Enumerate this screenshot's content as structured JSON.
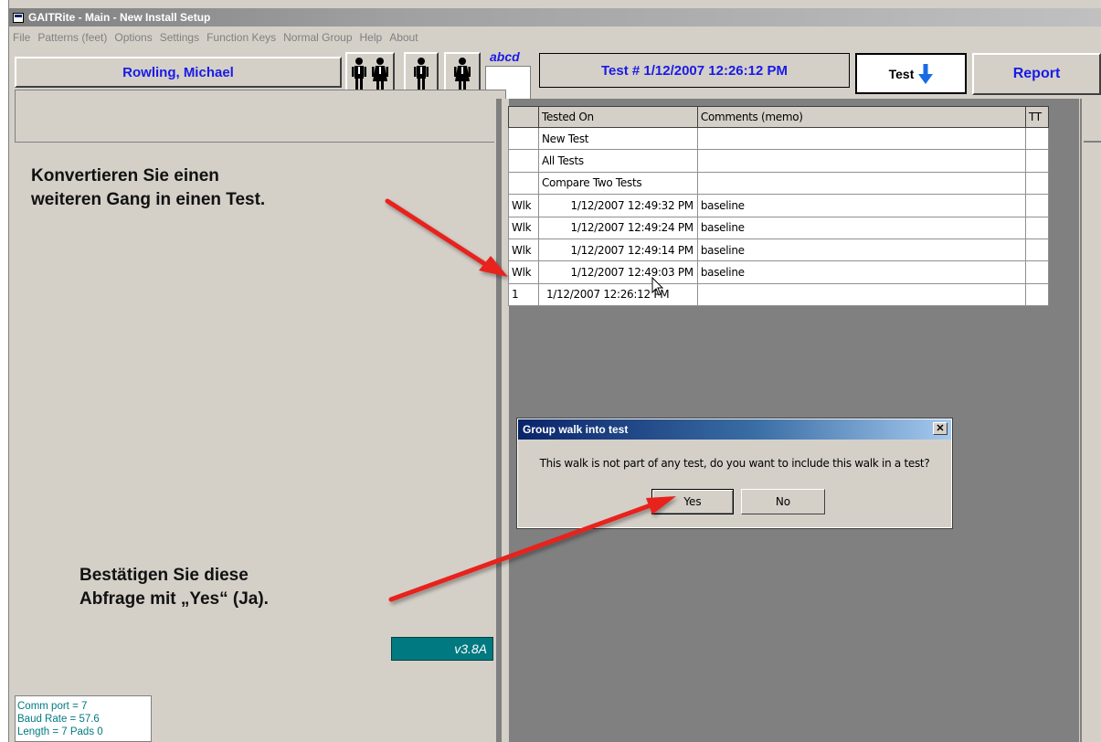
{
  "window": {
    "title": "GAITRite  - Main - New Install Setup"
  },
  "menu": [
    "File",
    "Patterns (feet)",
    "Options",
    "Settings",
    "Function Keys",
    "Normal Group",
    "Help",
    "About"
  ],
  "toolbar": {
    "patient_name": "Rowling, Michael",
    "abcd_label": "abcd",
    "test_label": "Test # 1/12/2007 12:26:12 PM",
    "test_down_label": "Test",
    "report_label": "Report"
  },
  "tests_table": {
    "headers": [
      "",
      "Tested On",
      "Comments (memo)",
      "TT"
    ],
    "rows": [
      {
        "type": "",
        "date": "New Test",
        "comment": "",
        "tt": ""
      },
      {
        "type": "",
        "date": "All Tests",
        "comment": "",
        "tt": ""
      },
      {
        "type": "",
        "date": "Compare Two Tests",
        "comment": "",
        "tt": ""
      },
      {
        "type": "Wlk",
        "date": "1/12/2007 12:49:32 PM",
        "comment": "baseline",
        "tt": ""
      },
      {
        "type": "Wlk",
        "date": "1/12/2007 12:49:24 PM",
        "comment": "baseline",
        "tt": ""
      },
      {
        "type": "Wlk",
        "date": "1/12/2007 12:49:14 PM",
        "comment": "baseline",
        "tt": ""
      },
      {
        "type": "Wlk",
        "date": "1/12/2007 12:49:03 PM",
        "comment": "baseline",
        "tt": ""
      },
      {
        "type": "1",
        "date": "1/12/2007 12:26:12 PM",
        "comment": "",
        "tt": ""
      }
    ]
  },
  "dialog": {
    "title": "Group walk into test",
    "close_glyph": "✕",
    "message": "This walk is not part of any test, do you want to include this walk in a test?",
    "yes_label": "Yes",
    "no_label": "No"
  },
  "annotations": {
    "convert_line1": "Konvertieren Sie einen",
    "convert_line2": "weiteren Gang in einen Test.",
    "confirm_line1": "Bestätigen Sie diese",
    "confirm_line2": "Abfrage mit „Yes“ (Ja).",
    "arrow_color": "#e8221e"
  },
  "version": "v3.8A",
  "status": {
    "comm_port": "Comm port = 7",
    "baud_rate": "Baud Rate = 57.6",
    "length": "Length = 7 Pads  0"
  },
  "icons": [
    "app-icon",
    "couple-icon",
    "man-icon",
    "woman-icon",
    "arrow-down-icon",
    "mouse-cursor-icon",
    "close-icon"
  ]
}
